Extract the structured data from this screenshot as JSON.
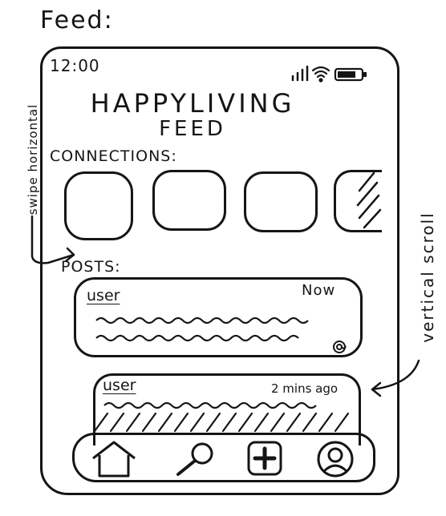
{
  "page": {
    "title": "Feed:"
  },
  "status_bar": {
    "time": "12:00"
  },
  "app": {
    "title": "HAPPYLIVING",
    "subtitle": "FEED"
  },
  "connections": {
    "label": "CONNECTIONS:",
    "count_visible": 4
  },
  "posts": {
    "label": "POSTS:",
    "items": [
      {
        "user": "user",
        "time": "Now",
        "has_icon": true
      },
      {
        "user": "user",
        "time": "2 mins ago",
        "has_icon": false
      }
    ]
  },
  "nav": {
    "items": [
      "home-icon",
      "search-icon",
      "add-icon",
      "profile-icon"
    ]
  },
  "annotations": {
    "left": "swipe horizontal",
    "right": "vertical scroll"
  }
}
